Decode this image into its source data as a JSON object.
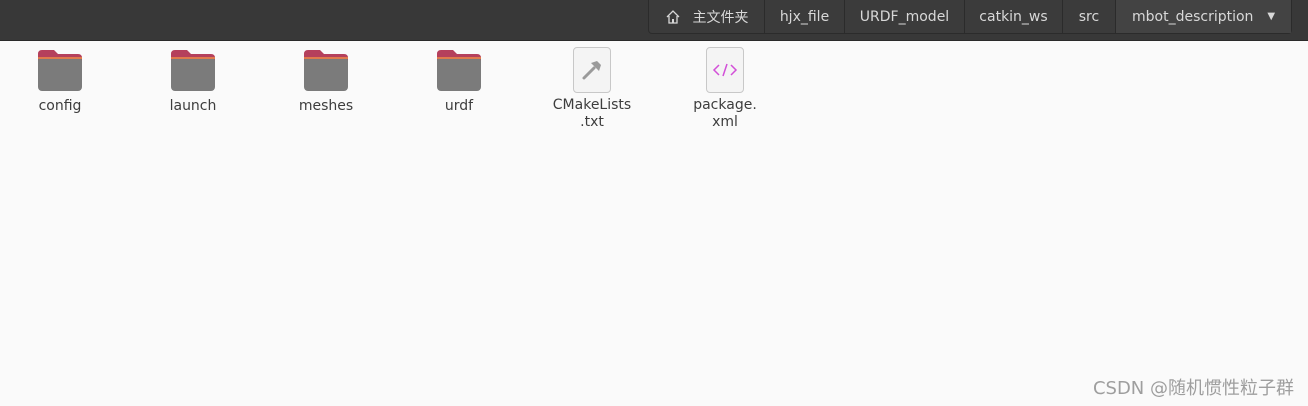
{
  "pathbar": {
    "home_label": "主文件夹",
    "crumbs": [
      "hjx_file",
      "URDF_model",
      "catkin_ws",
      "src",
      "mbot_description"
    ]
  },
  "files": [
    {
      "name": "config",
      "type": "folder"
    },
    {
      "name": "launch",
      "type": "folder"
    },
    {
      "name": "meshes",
      "type": "folder"
    },
    {
      "name": "urdf",
      "type": "folder"
    },
    {
      "name": "CMakeLists.txt",
      "display": "CMakeLists\n.txt",
      "type": "cmake-file"
    },
    {
      "name": "package.xml",
      "display": "package.\nxml",
      "type": "xml-file"
    }
  ],
  "watermark": "CSDN @随机惯性粒子群",
  "colors": {
    "topbar": "#383838",
    "folder_tab": "#b5405c",
    "folder_body": "#7b7b7b",
    "xml_accent": "#d24fd8"
  }
}
